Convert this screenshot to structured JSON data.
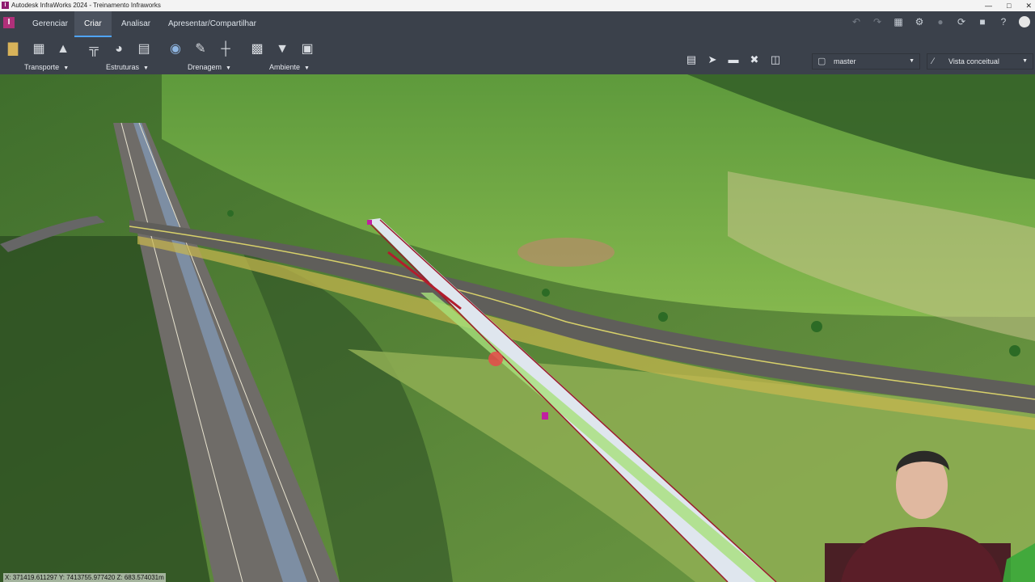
{
  "window": {
    "title": "Autodesk InfraWorks 2024 - Treinamento Infraworks",
    "app_icon": "I"
  },
  "tabs": [
    {
      "label": "Gerenciar",
      "active": false
    },
    {
      "label": "Criar",
      "active": true
    },
    {
      "label": "Analisar",
      "active": false
    },
    {
      "label": "Apresentar/Compartilhar",
      "active": false
    }
  ],
  "ribbon": {
    "groups": [
      {
        "label": "Transporte"
      },
      {
        "label": "Estruturas"
      },
      {
        "label": "Drenagem"
      },
      {
        "label": "Ambiente"
      }
    ]
  },
  "proposal": {
    "value": "master"
  },
  "visual_style": {
    "value": "Vista conceitual"
  },
  "status": {
    "coordinates": "X: 371419.611297 Y: 7413755.977420 Z: 683.574031m"
  },
  "colors": {
    "accent": "#4fa4ff",
    "app_brand": "#b0307a"
  }
}
